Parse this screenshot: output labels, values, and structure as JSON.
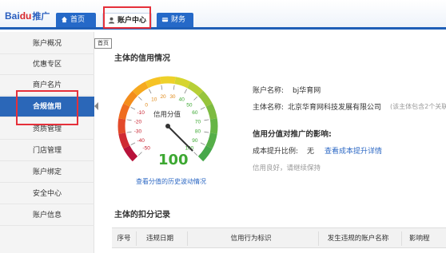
{
  "header": {
    "logo_text": "Bai",
    "logo_paw": "du",
    "logo_tag": "推广",
    "tabs": [
      {
        "label": "首页",
        "icon": "home-icon"
      },
      {
        "label": "账户中心",
        "icon": "user-icon"
      },
      {
        "label": "财务",
        "icon": "wallet-icon"
      }
    ]
  },
  "sidebar": {
    "items": [
      {
        "label": "账户概况"
      },
      {
        "label": "优惠专区"
      },
      {
        "label": "商户名片"
      },
      {
        "label": "合规信用"
      },
      {
        "label": "资质管理"
      },
      {
        "label": "门店管理"
      },
      {
        "label": "账户绑定"
      },
      {
        "label": "安全中心"
      },
      {
        "label": "账户信息"
      }
    ],
    "tooltip": "首页"
  },
  "credit": {
    "section_title": "主体的信用情况",
    "gauge_title": "信用分值",
    "score": "100",
    "score_value": 100,
    "history_link": "查看分值的历史波动情况",
    "ticks": [
      "-50",
      "-40",
      "-30",
      "-20",
      "-10",
      "0",
      "10",
      "20",
      "30",
      "40",
      "50",
      "60",
      "70",
      "80",
      "90",
      "100"
    ],
    "account_label": "账户名称:",
    "account_value": "bj华育网",
    "entity_label": "主体名称:",
    "entity_value": "北京华育网科技发展有限公司",
    "entity_note": "(该主体包含2个关联",
    "impact_title": "信用分值对推广的影响:",
    "cost_label": "成本提升比例:",
    "cost_value": "无",
    "cost_link": "查看成本提升详情",
    "status_text": "信用良好，请继续保持"
  },
  "deduction": {
    "section_title": "主体的扣分记录",
    "columns": [
      "序号",
      "违规日期",
      "信用行为标识",
      "发生违规的账户名称",
      "影响程"
    ]
  },
  "colors": {
    "brand_blue": "#1f5fb7",
    "highlight_red": "#e5303a",
    "score_green": "#3da832"
  }
}
